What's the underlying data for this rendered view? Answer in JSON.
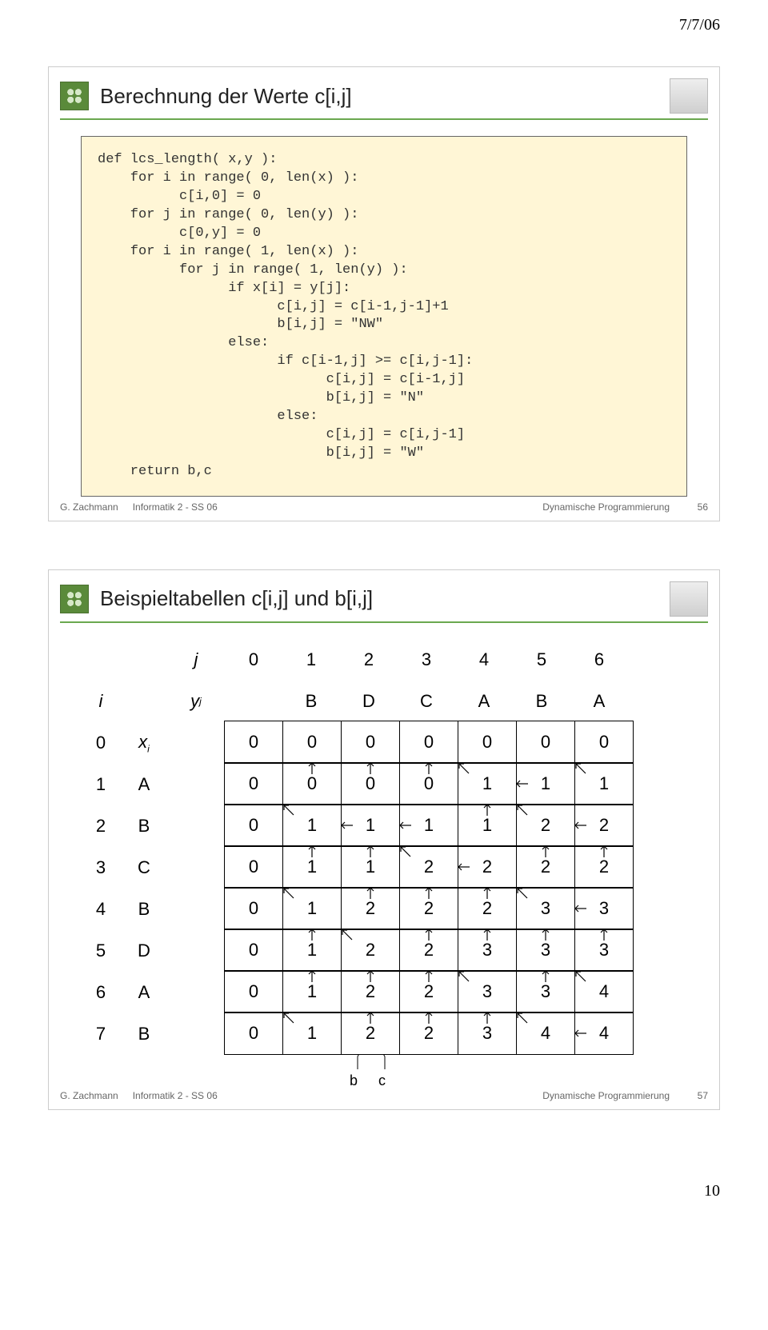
{
  "page_header_date": "7/7/06",
  "page_number": "10",
  "slide1": {
    "title": "Berechnung der Werte c[i,j]",
    "code": "def lcs_length( x,y ):\n    for i in range( 0, len(x) ):\n          c[i,0] = 0\n    for j in range( 0, len(y) ):\n          c[0,y] = 0\n    for i in range( 1, len(x) ):\n          for j in range( 1, len(y) ):\n                if x[i] = y[j]:\n                      c[i,j] = c[i-1,j-1]+1\n                      b[i,j] = \"NW\"\n                else:\n                      if c[i-1,j] >= c[i,j-1]:\n                            c[i,j] = c[i-1,j]\n                            b[i,j] = \"N\"\n                      else:\n                            c[i,j] = c[i,j-1]\n                            b[i,j] = \"W\"\n    return b,c",
    "footer_left": "G. Zachmann",
    "footer_mid": "Informatik 2 - SS 06",
    "footer_right": "Dynamische Programmierung",
    "footer_num": "56"
  },
  "slide2": {
    "title": "Beispieltabellen c[i,j] und b[i,j]",
    "col_header_j": "j",
    "col_header_i": "i",
    "col_labels": [
      "0",
      "1",
      "2",
      "3",
      "4",
      "5",
      "6"
    ],
    "col_symbol": "y",
    "col_symbol_sub": "j",
    "col_letters": [
      "B",
      "D",
      "C",
      "A",
      "B",
      "A"
    ],
    "row_symbol": "x",
    "row_symbol_sub": "i",
    "rows": [
      {
        "i": "0",
        "x": "x_i",
        "c": [
          0,
          0,
          0,
          0,
          0,
          0,
          0
        ],
        "dir": [
          "",
          "",
          "",
          "",
          "",
          "",
          ""
        ]
      },
      {
        "i": "1",
        "x": "A",
        "c": [
          0,
          0,
          0,
          0,
          1,
          1,
          1
        ],
        "dir": [
          "",
          "N",
          "N",
          "N",
          "NW",
          "W",
          "NW"
        ]
      },
      {
        "i": "2",
        "x": "B",
        "c": [
          0,
          1,
          1,
          1,
          1,
          2,
          2
        ],
        "dir": [
          "",
          "NW",
          "W",
          "W",
          "N",
          "NW",
          "W"
        ]
      },
      {
        "i": "3",
        "x": "C",
        "c": [
          0,
          1,
          1,
          2,
          2,
          2,
          2
        ],
        "dir": [
          "",
          "N",
          "N",
          "NW",
          "W",
          "N",
          "N"
        ]
      },
      {
        "i": "4",
        "x": "B",
        "c": [
          0,
          1,
          2,
          2,
          2,
          3,
          3
        ],
        "dir": [
          "",
          "NW",
          "N",
          "N",
          "N",
          "NW",
          "W"
        ]
      },
      {
        "i": "5",
        "x": "D",
        "c": [
          0,
          1,
          2,
          2,
          3,
          3,
          3
        ],
        "dir": [
          "",
          "N",
          "NW",
          "N",
          "N",
          "N",
          "N"
        ]
      },
      {
        "i": "6",
        "x": "A",
        "c": [
          0,
          1,
          2,
          2,
          3,
          3,
          4
        ],
        "dir": [
          "",
          "N",
          "N",
          "N",
          "NW",
          "N",
          "NW"
        ]
      },
      {
        "i": "7",
        "x": "B",
        "c": [
          0,
          1,
          2,
          2,
          3,
          4,
          4
        ],
        "dir": [
          "",
          "NW",
          "N",
          "N",
          "N",
          "NW",
          "W"
        ]
      }
    ],
    "hint_b": "b",
    "hint_c": "c",
    "footer_left": "G. Zachmann",
    "footer_mid": "Informatik 2 - SS 06",
    "footer_right": "Dynamische Programmierung",
    "footer_num": "57"
  }
}
